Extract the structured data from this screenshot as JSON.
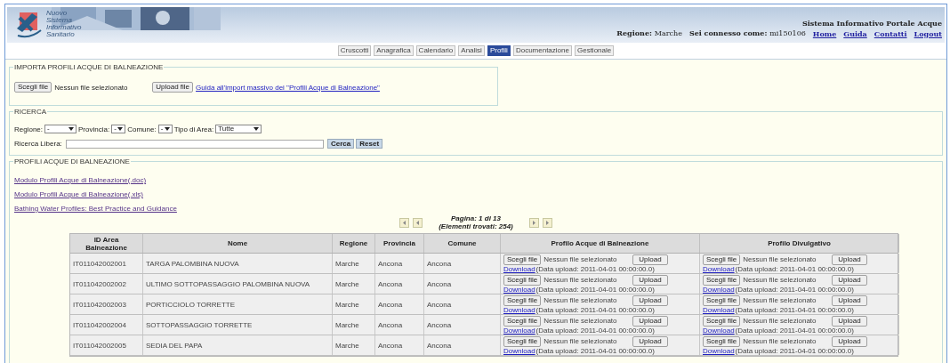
{
  "header": {
    "logo_text": [
      "Nuovo",
      "Sistema",
      "Informativo",
      "Sanitario"
    ],
    "system_title": "Sistema Informativo Portale Acque",
    "regione_label": "Regione:",
    "regione_value": "Marche",
    "user_label": "Sei connesso come:",
    "user_value": "mi150106",
    "links": [
      "Home",
      "Guida",
      "Contatti",
      "Logout"
    ]
  },
  "nav": [
    {
      "label": "Cruscotti",
      "selected": false
    },
    {
      "label": "Anagrafica",
      "selected": false
    },
    {
      "label": "Calendario",
      "selected": false
    },
    {
      "label": "Analisi",
      "selected": false
    },
    {
      "label": "Profili",
      "selected": true
    },
    {
      "label": "Documentazione",
      "selected": false
    },
    {
      "label": "Gestionale",
      "selected": false
    }
  ],
  "import_section": {
    "legend": "IMPORTA PROFILI ACQUE DI BALNEAZIONE",
    "choose_button": "Scegli file",
    "file_status": "Nessun file selezionato",
    "upload_button": "Upload file",
    "guide_link": "Guida all'import massivo dei \"Profili Acque di Balneazione\""
  },
  "search_section": {
    "legend": "RICERCA",
    "filters": [
      {
        "label": "Regione:",
        "value": "-"
      },
      {
        "label": "Provincia:",
        "value": "-"
      },
      {
        "label": "Comune:",
        "value": "-"
      },
      {
        "label": "Tipo di Area:",
        "value": "Tutte"
      }
    ],
    "free_search_label": "Ricerca Libera:",
    "search_button": "Cerca",
    "reset_button": "Reset"
  },
  "profiles_section": {
    "legend": "PROFILI ACQUE DI BALNEAZIONE",
    "links": [
      "Modulo Profili Acque di Balneazione(.doc)",
      "Modulo Profili Acque di Balneazione(.xls)",
      "Bathing Water Profiles: Best Practice and Guidance"
    ],
    "pagination": {
      "page_text": "Pagina: 1 di 13",
      "count_text": "(Elementi trovati: 254)"
    },
    "table": {
      "columns": [
        "ID Area Balneazione",
        "Nome",
        "Regione",
        "Provincia",
        "Comune",
        "Profilo Acque di Balneazione",
        "Profilo Divulgativo"
      ],
      "rows": [
        {
          "cells": [
            "IT011042002001",
            "TARGA PALOMBINA NUOVA",
            "Marche",
            "Ancona",
            "Ancona"
          ],
          "uploads": [
            {
              "choose": "Scegli file",
              "status": "Nessun file selezionato",
              "upload": "Upload",
              "download": "Download",
              "date": "(Data upload: 2011-04-01 00:00:00.0)"
            },
            {
              "choose": "Scegli file",
              "status": "Nessun file selezionato",
              "upload": "Upload",
              "download": "Download",
              "date": "(Data upload: 2011-04-01 00:00:00.0)"
            }
          ]
        },
        {
          "cells": [
            "IT011042002002",
            "ULTIMO SOTTOPASSAGGIO PALOMBINA NUOVA",
            "Marche",
            "Ancona",
            "Ancona"
          ],
          "uploads": [
            {
              "choose": "Scegli file",
              "status": "Nessun file selezionato",
              "upload": "Upload",
              "download": "Download",
              "date": "(Data upload: 2011-04-01 00:00:00.0)"
            },
            {
              "choose": "Scegli file",
              "status": "Nessun file selezionato",
              "upload": "Upload",
              "download": "Download",
              "date": "(Data upload: 2011-04-01 00:00:00.0)"
            }
          ]
        },
        {
          "cells": [
            "IT011042002003",
            "PORTICCIOLO TORRETTE",
            "Marche",
            "Ancona",
            "Ancona"
          ],
          "uploads": [
            {
              "choose": "Scegli file",
              "status": "Nessun file selezionato",
              "upload": "Upload",
              "download": "Download",
              "date": "(Data upload: 2011-04-01 00:00:00.0)"
            },
            {
              "choose": "Scegli file",
              "status": "Nessun file selezionato",
              "upload": "Upload",
              "download": "Download",
              "date": "(Data upload: 2011-04-01 00:00:00.0)"
            }
          ]
        },
        {
          "cells": [
            "IT011042002004",
            "SOTTOPASSAGGIO TORRETTE",
            "Marche",
            "Ancona",
            "Ancona"
          ],
          "uploads": [
            {
              "choose": "Scegli file",
              "status": "Nessun file selezionato",
              "upload": "Upload",
              "download": "Download",
              "date": "(Data upload: 2011-04-01 00:00:00.0)"
            },
            {
              "choose": "Scegli file",
              "status": "Nessun file selezionato",
              "upload": "Upload",
              "download": "Download",
              "date": "(Data upload: 2011-04-01 00:00:00.0)"
            }
          ]
        },
        {
          "cells": [
            "IT011042002005",
            "SEDIA DEL PAPA",
            "Marche",
            "Ancona",
            "Ancona"
          ],
          "uploads": [
            {
              "choose": "Scegli file",
              "status": "Nessun file selezionato",
              "upload": "Upload",
              "download": "Download",
              "date": "(Data upload: 2011-04-01 00:00:00.0)"
            },
            {
              "choose": "Scegli file",
              "status": "Nessun file selezionato",
              "upload": "Upload",
              "download": "Download",
              "date": "(Data upload: 2011-04-01 00:00:00.0)"
            }
          ]
        }
      ]
    }
  }
}
